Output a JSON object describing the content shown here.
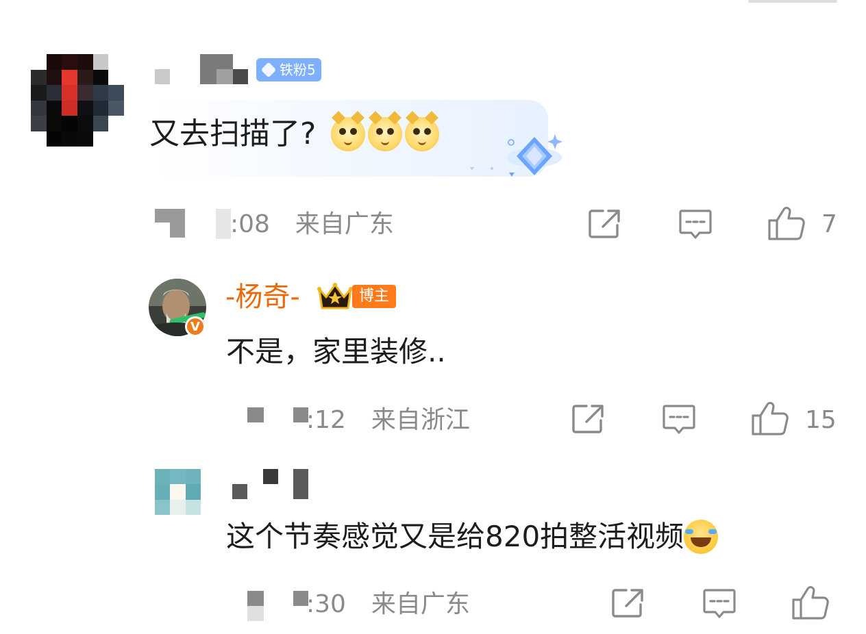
{
  "comment_main": {
    "badge_label": "铁粉5",
    "text": "又去扫描了?",
    "emoji_names": [
      "doge-emoji",
      "doge-emoji",
      "doge-emoji"
    ],
    "time_suffix": ":08",
    "location": "来自广东",
    "like_count": "7"
  },
  "reply_author": {
    "name": "-杨奇-",
    "badge_label": "博主",
    "text": "不是，家里装修..",
    "time_suffix": ":12",
    "location": "来自浙江",
    "like_count": "15"
  },
  "reply_two": {
    "text": "这个节奏感觉又是给820拍整活视频",
    "emoji_name": "laugh-cry-emoji",
    "time_suffix": ":30",
    "location": "来自广东",
    "like_count": ""
  },
  "colors": {
    "accent_name": "#e86a0c",
    "meta_gray": "#8a8a8a",
    "fan_badge": "#7fb0ff",
    "host_badge": "#ff7a1a"
  }
}
